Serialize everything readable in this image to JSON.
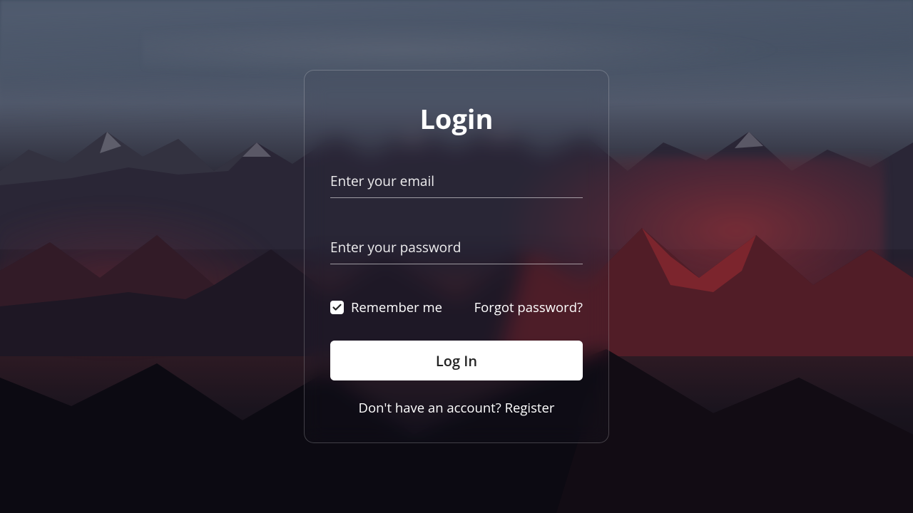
{
  "card": {
    "title": "Login",
    "email_placeholder": "Enter your email",
    "password_placeholder": "Enter your password",
    "remember_label": "Remember me",
    "remember_checked": true,
    "forgot_label": "Forgot password?",
    "submit_label": "Log In",
    "register_prompt": "Don't have an account? ",
    "register_link": "Register"
  }
}
